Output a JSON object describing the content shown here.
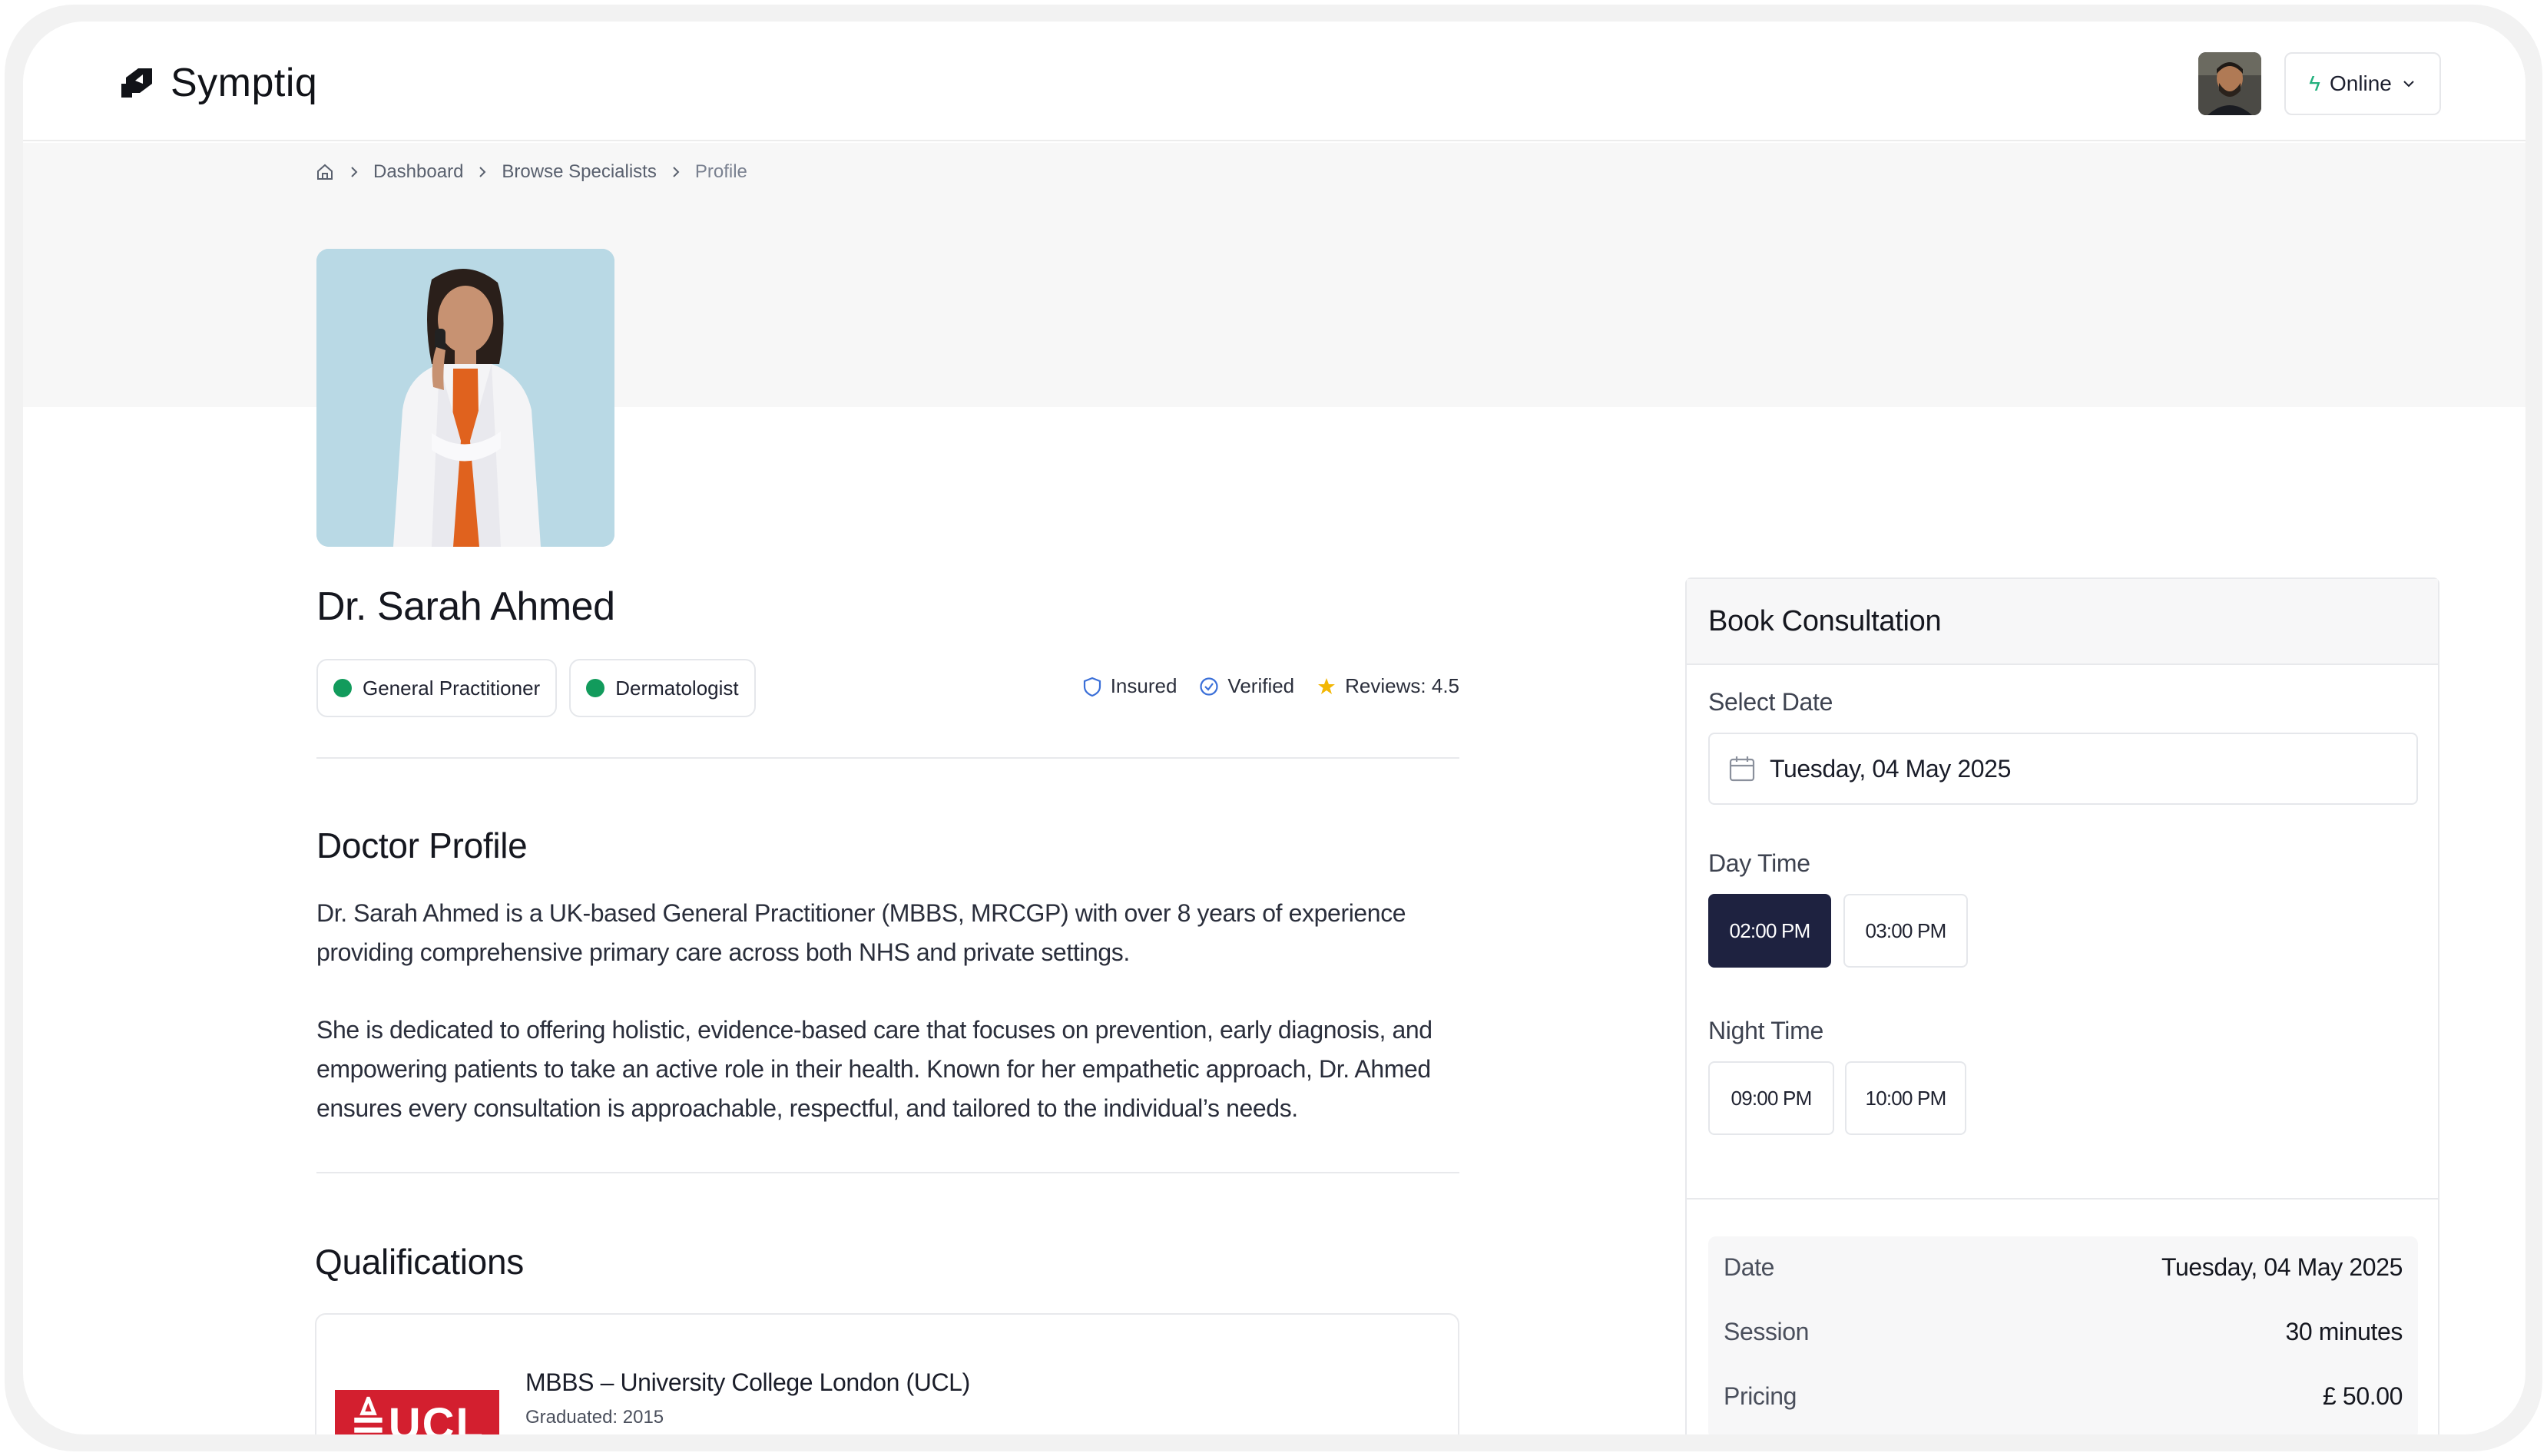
{
  "app": {
    "name": "Symptiq"
  },
  "header": {
    "status_label": "Online"
  },
  "breadcrumb": {
    "items": [
      "Dashboard",
      "Browse Specialists",
      "Profile"
    ]
  },
  "doctor": {
    "name": "Dr. Sarah Ahmed",
    "tags": [
      "General Practitioner",
      "Dermatologist"
    ],
    "badges": {
      "insured": "Insured",
      "verified": "Verified",
      "reviews": "Reviews: 4.5"
    }
  },
  "profile": {
    "heading": "Doctor Profile",
    "paragraph1": "Dr. Sarah Ahmed is a UK-based General Practitioner (MBBS, MRCGP) with over 8 years of experience providing comprehensive primary care across both NHS and private settings.",
    "paragraph2": "She is dedicated to offering holistic, evidence-based care that focuses on prevention, early diagnosis, and empowering patients to take an active role in their health. Known for her empathetic approach, Dr. Ahmed ensures every consultation is approachable, respectful, and tailored to the individual’s needs."
  },
  "qualifications": {
    "heading": "Qualifications",
    "items": [
      {
        "logo_text": "≜UCL",
        "title": "MBBS – University College London (UCL)",
        "subtitle": "Graduated: 2015"
      }
    ]
  },
  "booking": {
    "title": "Book Consultation",
    "select_date_label": "Select Date",
    "date_value": "Tuesday, 04 May 2025",
    "day_time_label": "Day Time",
    "day_slots": [
      "02:00 PM",
      "03:00 PM"
    ],
    "night_time_label": "Night Time",
    "night_slots": [
      "09:00 PM",
      "10:00 PM"
    ],
    "selected_slot": "02:00 PM",
    "summary": {
      "date_label": "Date",
      "date_value": "Tuesday, 04 May 2025",
      "session_label": "Session",
      "session_value": "30 minutes",
      "pricing_label": "Pricing",
      "pricing_value": "£ 50.00"
    }
  },
  "colors": {
    "accent_dark": "#1e2240",
    "tag_dot": "#129b5c",
    "online_bolt": "#22b07d",
    "star": "#f2b705",
    "ucl_red": "#d31f2f"
  }
}
